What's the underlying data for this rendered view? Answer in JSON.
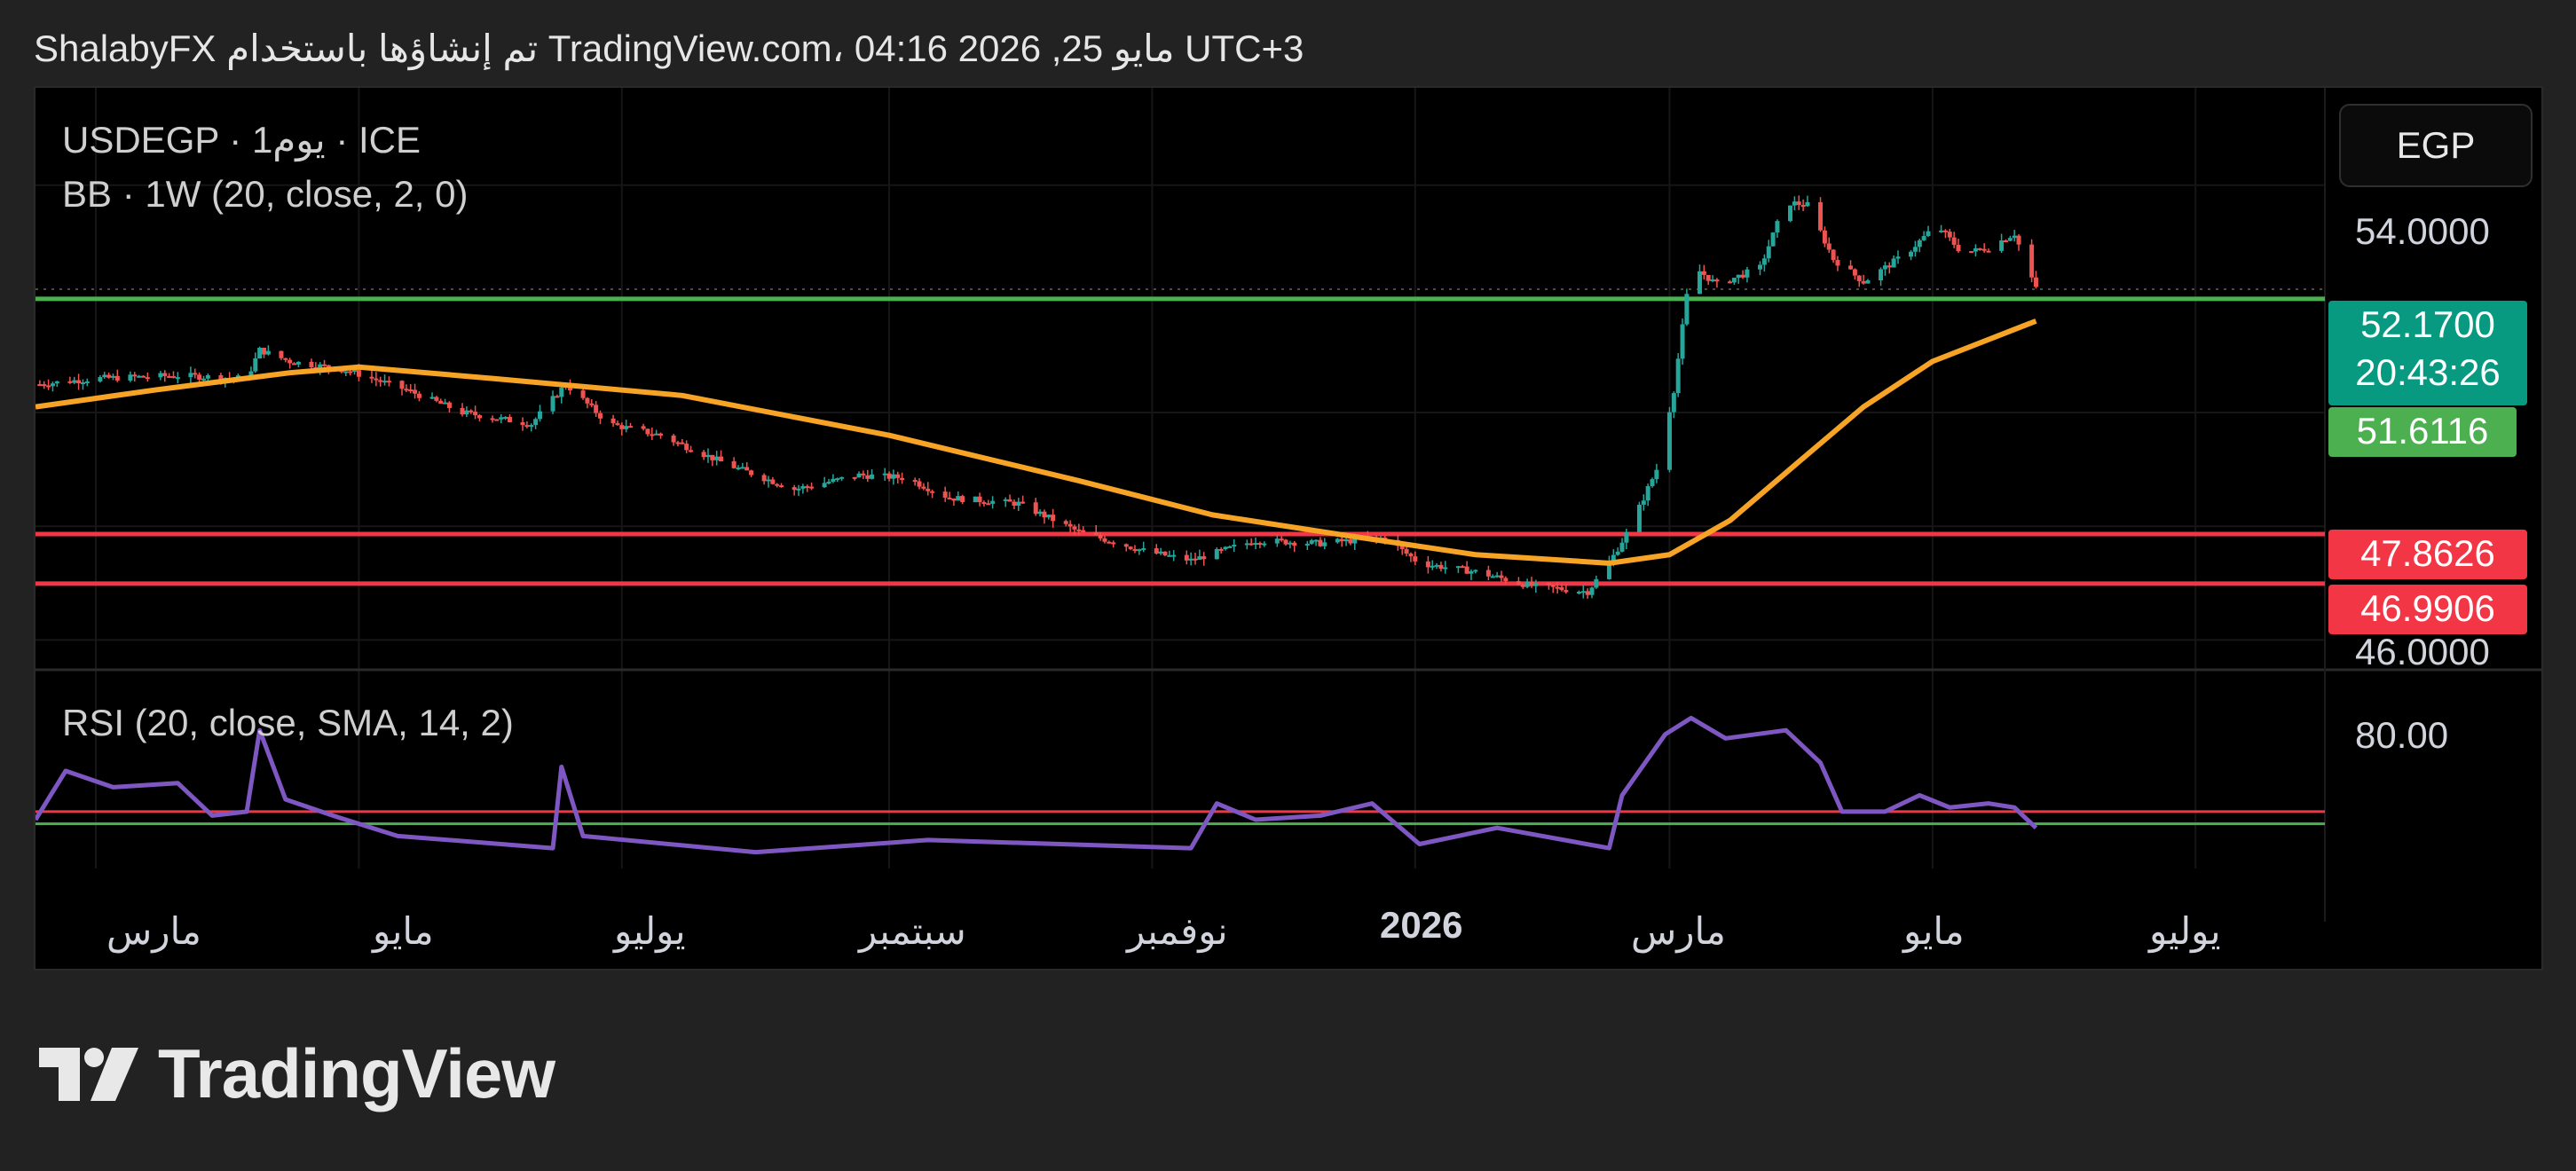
{
  "header": {
    "attribution": "ShalabyFX تم إنشاؤها باستخدام TradingView.com، 04:16 2026 ,25 مايو UTC+3"
  },
  "toolbar": {
    "currency": "EGP"
  },
  "legend": {
    "symbol_line": "USDEGP · 1يوم · ICE",
    "bb_line": "BB · 1W (20, close, 2, 0)",
    "rsi_line": "RSI (20, close, SMA, 14, 2)"
  },
  "price_axis": {
    "tick_top": "54.0000",
    "tick_bottom": "46.0000"
  },
  "price_tags": {
    "last_price": "52.1700",
    "countdown": "20:43:26",
    "bb_basis": "51.6116",
    "level_upper": "47.8626",
    "level_lower": "46.9906"
  },
  "rsi_axis": {
    "tick": "80.00"
  },
  "time_axis": {
    "labels": [
      "مارس",
      "مايو",
      "يوليو",
      "سبتمبر",
      "نوفمبر",
      "2026",
      "مارس",
      "مايو",
      "يوليو"
    ]
  },
  "colors": {
    "up": "#26a69a",
    "down": "#ef5350",
    "bb": "#f7a325",
    "green_line": "#4caf50",
    "red_line": "#f23645",
    "rsi": "#7e57c2",
    "last_tag": "#089981",
    "bb_tag": "#4caf50",
    "red_tag": "#f23645"
  },
  "branding": {
    "logo_text": "TradingView"
  },
  "chart_data": {
    "type": "candlestick",
    "symbol": "USDEGP",
    "interval": "1D",
    "x_range": [
      "2025-02-15",
      "2026-07-31"
    ],
    "price_ylim": [
      45.6,
      55.4
    ],
    "close_path": [
      {
        "date": "2025-02-16",
        "close": 50.5
      },
      {
        "date": "2025-03-01",
        "close": 50.6
      },
      {
        "date": "2025-03-20",
        "close": 50.65
      },
      {
        "date": "2025-04-05",
        "close": 50.6
      },
      {
        "date": "2025-04-08",
        "close": 51.1
      },
      {
        "date": "2025-04-15",
        "close": 50.9
      },
      {
        "date": "2025-04-28",
        "close": 50.75
      },
      {
        "date": "2025-05-12",
        "close": 50.4
      },
      {
        "date": "2025-05-25",
        "close": 50.0
      },
      {
        "date": "2025-06-10",
        "close": 49.8
      },
      {
        "date": "2025-06-18",
        "close": 50.5
      },
      {
        "date": "2025-06-28",
        "close": 49.8
      },
      {
        "date": "2025-07-10",
        "close": 49.6
      },
      {
        "date": "2025-07-25",
        "close": 49.1
      },
      {
        "date": "2025-08-10",
        "close": 48.65
      },
      {
        "date": "2025-08-25",
        "close": 48.9
      },
      {
        "date": "2025-09-05",
        "close": 48.85
      },
      {
        "date": "2025-09-15",
        "close": 48.5
      },
      {
        "date": "2025-10-01",
        "close": 48.4
      },
      {
        "date": "2025-10-15",
        "close": 47.9
      },
      {
        "date": "2025-10-31",
        "close": 47.55
      },
      {
        "date": "2025-11-10",
        "close": 47.4
      },
      {
        "date": "2025-11-25",
        "close": 47.75
      },
      {
        "date": "2025-12-10",
        "close": 47.7
      },
      {
        "date": "2025-12-25",
        "close": 47.8
      },
      {
        "date": "2026-01-02",
        "close": 47.35
      },
      {
        "date": "2026-01-15",
        "close": 47.2
      },
      {
        "date": "2026-01-28",
        "close": 46.95
      },
      {
        "date": "2026-02-10",
        "close": 46.85
      },
      {
        "date": "2026-02-15",
        "close": 47.35
      },
      {
        "date": "2026-02-20",
        "close": 48.0
      },
      {
        "date": "2026-02-26",
        "close": 49.0
      },
      {
        "date": "2026-03-02",
        "close": 50.4
      },
      {
        "date": "2026-03-06",
        "close": 52.6
      },
      {
        "date": "2026-03-12",
        "close": 52.25
      },
      {
        "date": "2026-03-22",
        "close": 52.55
      },
      {
        "date": "2026-03-28",
        "close": 53.7
      },
      {
        "date": "2026-04-02",
        "close": 53.65
      },
      {
        "date": "2026-04-08",
        "close": 52.7
      },
      {
        "date": "2026-04-15",
        "close": 52.3
      },
      {
        "date": "2026-04-25",
        "close": 52.8
      },
      {
        "date": "2026-05-02",
        "close": 53.3
      },
      {
        "date": "2026-05-08",
        "close": 52.8
      },
      {
        "date": "2026-05-14",
        "close": 52.9
      },
      {
        "date": "2026-05-20",
        "close": 53.15
      },
      {
        "date": "2026-05-25",
        "close": 52.17
      }
    ],
    "bollinger_basis_1w": [
      {
        "date": "2025-02-15",
        "value": 50.1
      },
      {
        "date": "2025-03-15",
        "value": 50.4
      },
      {
        "date": "2025-04-15",
        "value": 50.7
      },
      {
        "date": "2025-05-01",
        "value": 50.8
      },
      {
        "date": "2025-06-01",
        "value": 50.6
      },
      {
        "date": "2025-07-15",
        "value": 50.3
      },
      {
        "date": "2025-09-01",
        "value": 49.6
      },
      {
        "date": "2025-10-15",
        "value": 48.8
      },
      {
        "date": "2025-11-15",
        "value": 48.2
      },
      {
        "date": "2025-12-15",
        "value": 47.85
      },
      {
        "date": "2026-01-15",
        "value": 47.5
      },
      {
        "date": "2026-02-15",
        "value": 47.35
      },
      {
        "date": "2026-03-01",
        "value": 47.5
      },
      {
        "date": "2026-03-15",
        "value": 48.1
      },
      {
        "date": "2026-04-01",
        "value": 49.2
      },
      {
        "date": "2026-04-15",
        "value": 50.1
      },
      {
        "date": "2026-05-01",
        "value": 50.9
      },
      {
        "date": "2026-05-25",
        "value": 51.61
      }
    ],
    "horizontal_levels": [
      52.0,
      47.8626,
      46.9906
    ],
    "last_price": 52.17,
    "rsi": {
      "length": 20,
      "ylim": [
        42,
        90
      ],
      "bands": [
        56,
        53
      ],
      "points": [
        {
          "date": "2025-02-15",
          "value": 54
        },
        {
          "date": "2025-02-22",
          "value": 66
        },
        {
          "date": "2025-03-05",
          "value": 62
        },
        {
          "date": "2025-03-20",
          "value": 63
        },
        {
          "date": "2025-03-28",
          "value": 55
        },
        {
          "date": "2025-04-05",
          "value": 56
        },
        {
          "date": "2025-04-08",
          "value": 76
        },
        {
          "date": "2025-04-14",
          "value": 59
        },
        {
          "date": "2025-04-25",
          "value": 55
        },
        {
          "date": "2025-05-10",
          "value": 50
        },
        {
          "date": "2025-06-15",
          "value": 47
        },
        {
          "date": "2025-06-17",
          "value": 67
        },
        {
          "date": "2025-06-22",
          "value": 50
        },
        {
          "date": "2025-08-01",
          "value": 46
        },
        {
          "date": "2025-09-10",
          "value": 49
        },
        {
          "date": "2025-11-10",
          "value": 47
        },
        {
          "date": "2025-11-16",
          "value": 58
        },
        {
          "date": "2025-11-25",
          "value": 54
        },
        {
          "date": "2025-12-10",
          "value": 55
        },
        {
          "date": "2025-12-22",
          "value": 58
        },
        {
          "date": "2026-01-02",
          "value": 48
        },
        {
          "date": "2026-01-20",
          "value": 52
        },
        {
          "date": "2026-02-15",
          "value": 47
        },
        {
          "date": "2026-02-18",
          "value": 60
        },
        {
          "date": "2026-02-28",
          "value": 75
        },
        {
          "date": "2026-03-06",
          "value": 79
        },
        {
          "date": "2026-03-14",
          "value": 74
        },
        {
          "date": "2026-03-28",
          "value": 76
        },
        {
          "date": "2026-04-05",
          "value": 68
        },
        {
          "date": "2026-04-10",
          "value": 56
        },
        {
          "date": "2026-04-20",
          "value": 56
        },
        {
          "date": "2026-04-28",
          "value": 60
        },
        {
          "date": "2026-05-05",
          "value": 57
        },
        {
          "date": "2026-05-14",
          "value": 58
        },
        {
          "date": "2026-05-20",
          "value": 57
        },
        {
          "date": "2026-05-25",
          "value": 52
        }
      ]
    }
  }
}
